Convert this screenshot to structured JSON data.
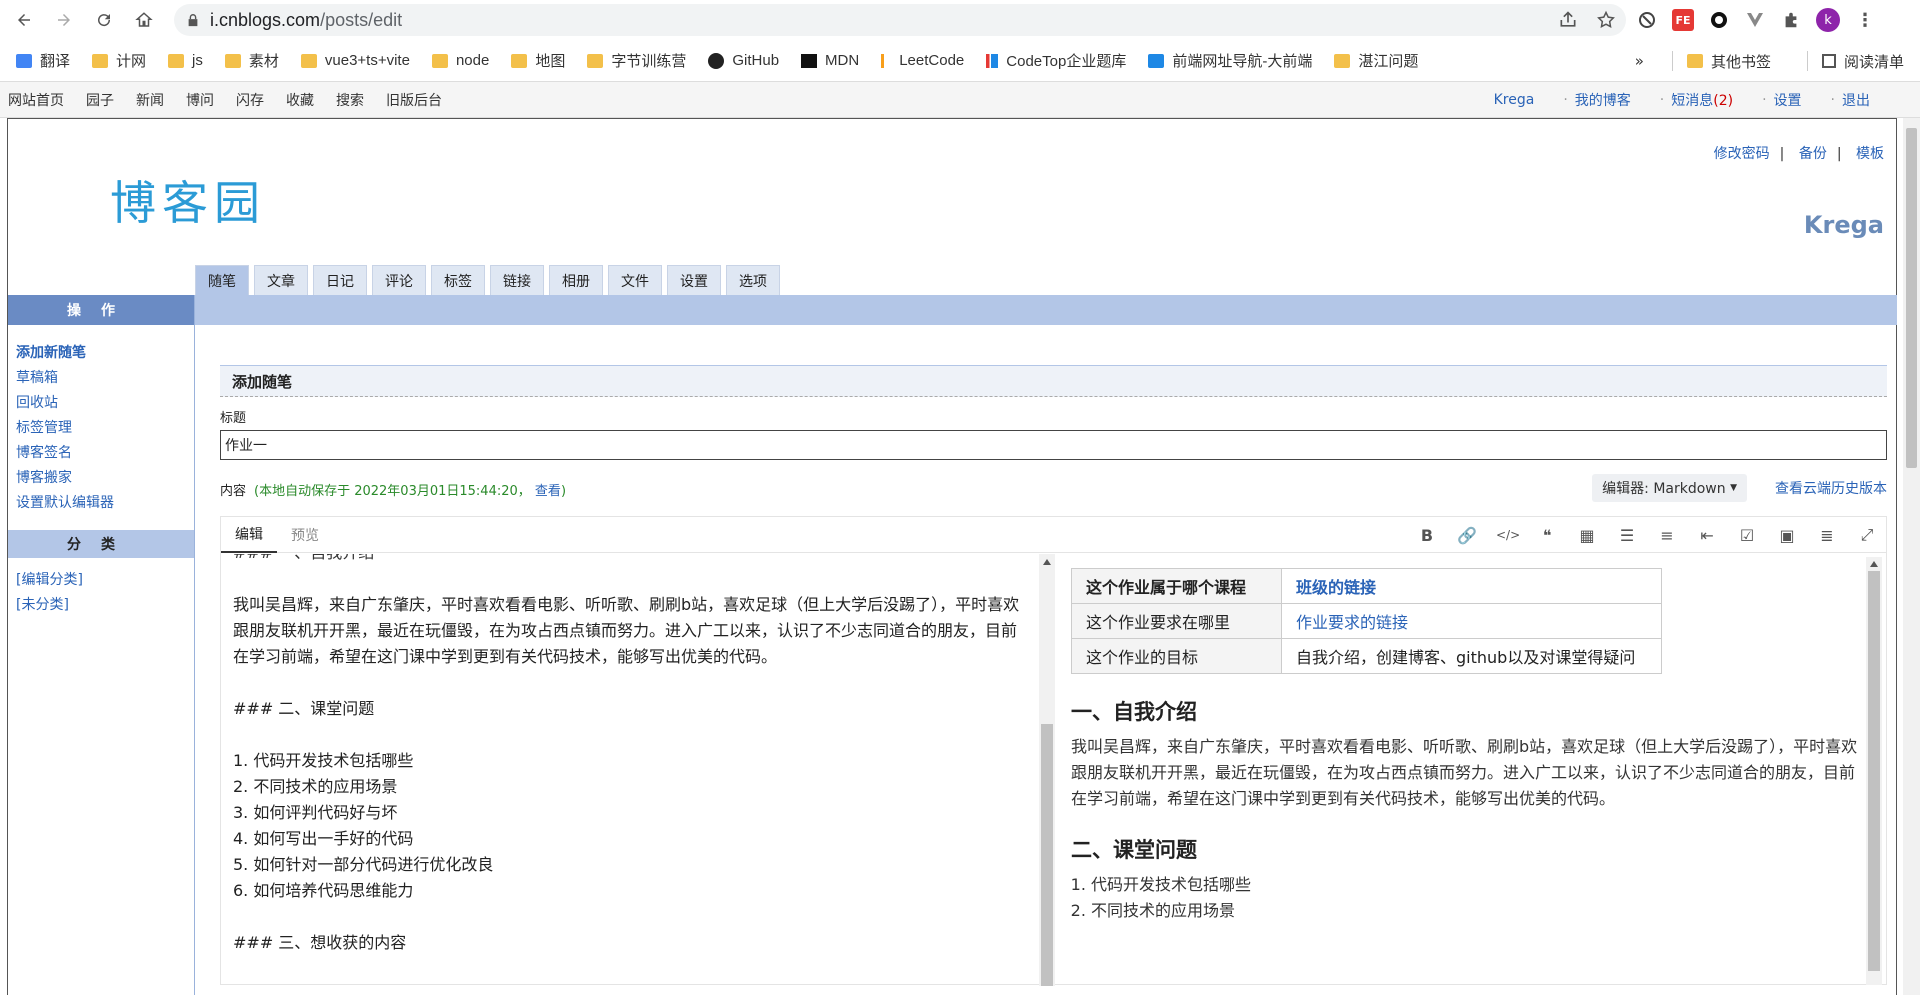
{
  "browser": {
    "url_host": "i.cnblogs.com",
    "url_path": "/posts/edit",
    "profile_initial": "k",
    "bookmarks": [
      {
        "label": "翻译",
        "icon": "translate-icon"
      },
      {
        "label": "计网",
        "icon": "folder-icon"
      },
      {
        "label": "js",
        "icon": "folder-icon"
      },
      {
        "label": "素材",
        "icon": "folder-icon"
      },
      {
        "label": "vue3+ts+vite",
        "icon": "folder-icon"
      },
      {
        "label": "node",
        "icon": "folder-icon"
      },
      {
        "label": "地图",
        "icon": "folder-icon"
      },
      {
        "label": "字节训练营",
        "icon": "folder-icon"
      },
      {
        "label": "GitHub",
        "icon": "github-icon"
      },
      {
        "label": "MDN",
        "icon": "mdn-icon"
      },
      {
        "label": "LeetCode",
        "icon": "leetcode-icon"
      },
      {
        "label": "CodeTop企业题库",
        "icon": "chart-icon"
      },
      {
        "label": "前端网址导航-大前端",
        "icon": "bookmark-icon"
      },
      {
        "label": "湛江问题",
        "icon": "folder-icon"
      }
    ],
    "bookmarks_overflow": "»",
    "other_bookmarks": "其他书签",
    "reading_list": "阅读清单"
  },
  "sitenav": {
    "items": [
      "网站首页",
      "园子",
      "新闻",
      "博问",
      "闪存",
      "收藏",
      "搜索",
      "旧版后台"
    ],
    "right": {
      "user": "Krega",
      "myblog": "我的博客",
      "messages": "短消息",
      "messages_count": "(2)",
      "settings": "设置",
      "logout": "退出"
    }
  },
  "header": {
    "logo_text": "博客园",
    "links": [
      "修改密码",
      "备份",
      "模板"
    ],
    "username": "Krega"
  },
  "tabs": [
    "随笔",
    "文章",
    "日记",
    "评论",
    "标签",
    "链接",
    "相册",
    "文件",
    "设置",
    "选项"
  ],
  "sidebar": {
    "ops_title": "操作",
    "ops_items": [
      "添加新随笔",
      "草稿箱",
      "回收站",
      "标签管理",
      "博客签名",
      "博客搬家",
      "设置默认编辑器"
    ],
    "cat_title": "分类",
    "cat_items": [
      "[编辑分类]",
      "[未分类]"
    ]
  },
  "main": {
    "section_title": "添加随笔",
    "title_label": "标题",
    "title_value": "作业一",
    "content_label": "内容",
    "autosave_text": "(本地自动保存于 2022年03月01日15:44:20，",
    "autosave_link": "查看",
    "autosave_close": ")",
    "editor_select": "编辑器: Markdown",
    "history_link": "查看云端历史版本"
  },
  "editor": {
    "tab_edit": "编辑",
    "tab_preview": "预览",
    "tools": [
      "bold-icon",
      "link-icon",
      "code-icon",
      "quote-icon",
      "table-icon",
      "ul-icon",
      "ol-icon",
      "indent-icon",
      "checkbox-icon",
      "image-icon",
      "align-icon",
      "fullscreen-icon"
    ],
    "source": {
      "cut_line": "### 一、自我介绍",
      "intro": "我叫吴昌辉，来自广东肇庆，平时喜欢看看电影、听听歌、刷刷b站，喜欢足球（但上大学后没踢了），平时喜欢跟朋友联机开开黑，最近在玩僵毁，在为攻占西点镇而努力。进入广工以来，认识了不少志同道合的朋友，目前在学习前端，希望在这门课中学到更到有关代码技术，能够写出优美的代码。",
      "h2": "### 二、课堂问题",
      "list": [
        "1. 代码开发技术包括哪些",
        "2. 不同技术的应用场景",
        "3. 如何评判代码好与坏",
        "4. 如何写出一手好的代码",
        "5. 如何针对一部分代码进行优化改良",
        "6. 如何培养代码思维能力"
      ],
      "h3": "### 三、想收获的内容"
    },
    "preview": {
      "table": [
        {
          "k": "这个作业属于哪个课程",
          "v": "班级的链接",
          "link": true
        },
        {
          "k": "这个作业要求在哪里",
          "v": "作业要求的链接",
          "link": true
        },
        {
          "k": "这个作业的目标",
          "v": "自我介绍，创建博客、github以及对课堂得疑问",
          "link": false
        }
      ],
      "h1": "一、自我介绍",
      "intro": "我叫吴昌辉，来自广东肇庆，平时喜欢看看电影、听听歌、刷刷b站，喜欢足球（但上大学后没踢了），平时喜欢跟朋友联机开开黑，最近在玩僵毁，在为攻占西点镇而努力。进入广工以来，认识了不少志同道合的朋友，目前在学习前端，希望在这门课中学到更到有关代码技术，能够写出优美的代码。",
      "h2": "二、课堂问题",
      "list": [
        "代码开发技术包括哪些",
        "不同技术的应用场景"
      ]
    }
  }
}
